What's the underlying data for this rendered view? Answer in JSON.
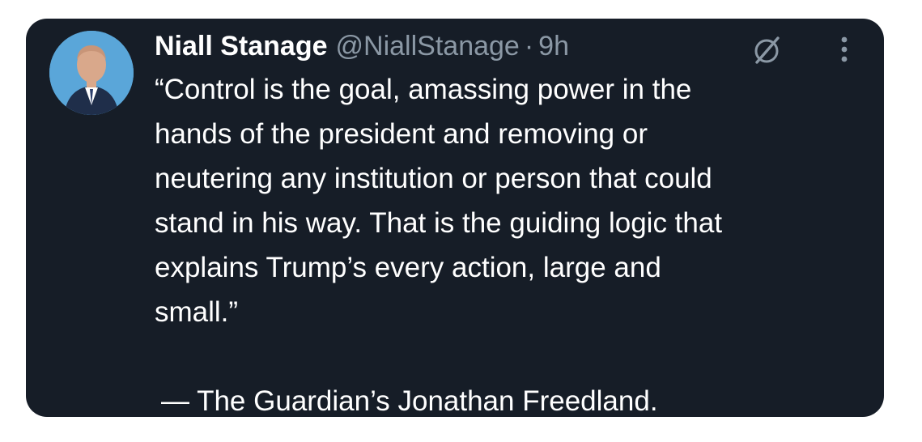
{
  "tweet": {
    "author_name": "Niall Stanage",
    "handle": "@NiallStanage",
    "separator": "·",
    "time": "9h",
    "text": "“Control is the goal, amassing power in the\nhands of the president and removing or\nneutering any institution or person that could\nstand in his way. That is the guiding logic that\nexplains Trump’s every action, large and\nsmall.”",
    "attribution": "— The Guardian’s Jonathan Freedland."
  },
  "icons": {
    "avatar": "avatar",
    "grok": "grok-icon",
    "more": "more-icon"
  },
  "colors": {
    "background": "#161d27",
    "text": "#ffffff",
    "secondary_text": "#8b98a5",
    "page": "#ffffff"
  }
}
